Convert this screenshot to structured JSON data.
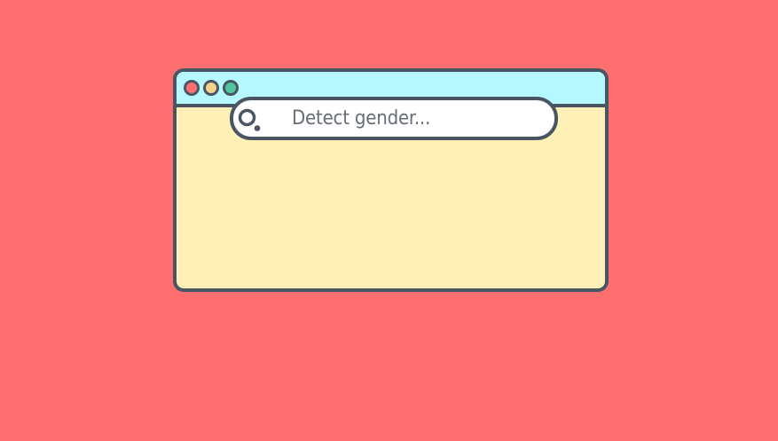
{
  "window": {
    "controls": [
      {
        "name": "close",
        "color": "#ff6f6f"
      },
      {
        "name": "minimize",
        "color": "#f3d28a"
      },
      {
        "name": "maximize",
        "color": "#53c6a0"
      }
    ]
  },
  "search": {
    "placeholder": "Detect gender...",
    "icon": "search-icon"
  },
  "colors": {
    "background": "#ff6f6f",
    "window_body": "#fff0b8",
    "titlebar": "#b5f8ff",
    "outline": "#4a5563",
    "search_bg": "#ffffff",
    "text": "#666e78"
  }
}
